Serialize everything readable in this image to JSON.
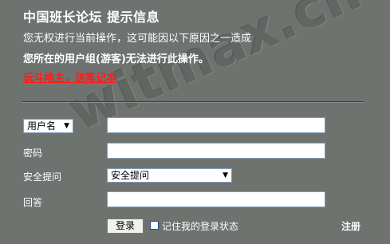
{
  "header": {
    "title": "中国班长论坛 提示信息"
  },
  "message": {
    "reason": "您无权进行当前操作，这可能因以下原因之一造成",
    "bold_reason": "您所在的用户组(游客)无法进行此操作。",
    "promo_link": "玩斗地主，送笔记本"
  },
  "watermark": "witmax.cn",
  "login_form": {
    "username_type_select": "用户名",
    "username_value": "",
    "password_label": "密码",
    "password_value": "",
    "security_question_label": "安全提问",
    "security_question_select": "安全提问",
    "answer_label": "回答",
    "answer_value": "",
    "login_button": "登录",
    "remember_label": "记住我的登录状态",
    "remember_checked": false,
    "register_link": "注册"
  }
}
